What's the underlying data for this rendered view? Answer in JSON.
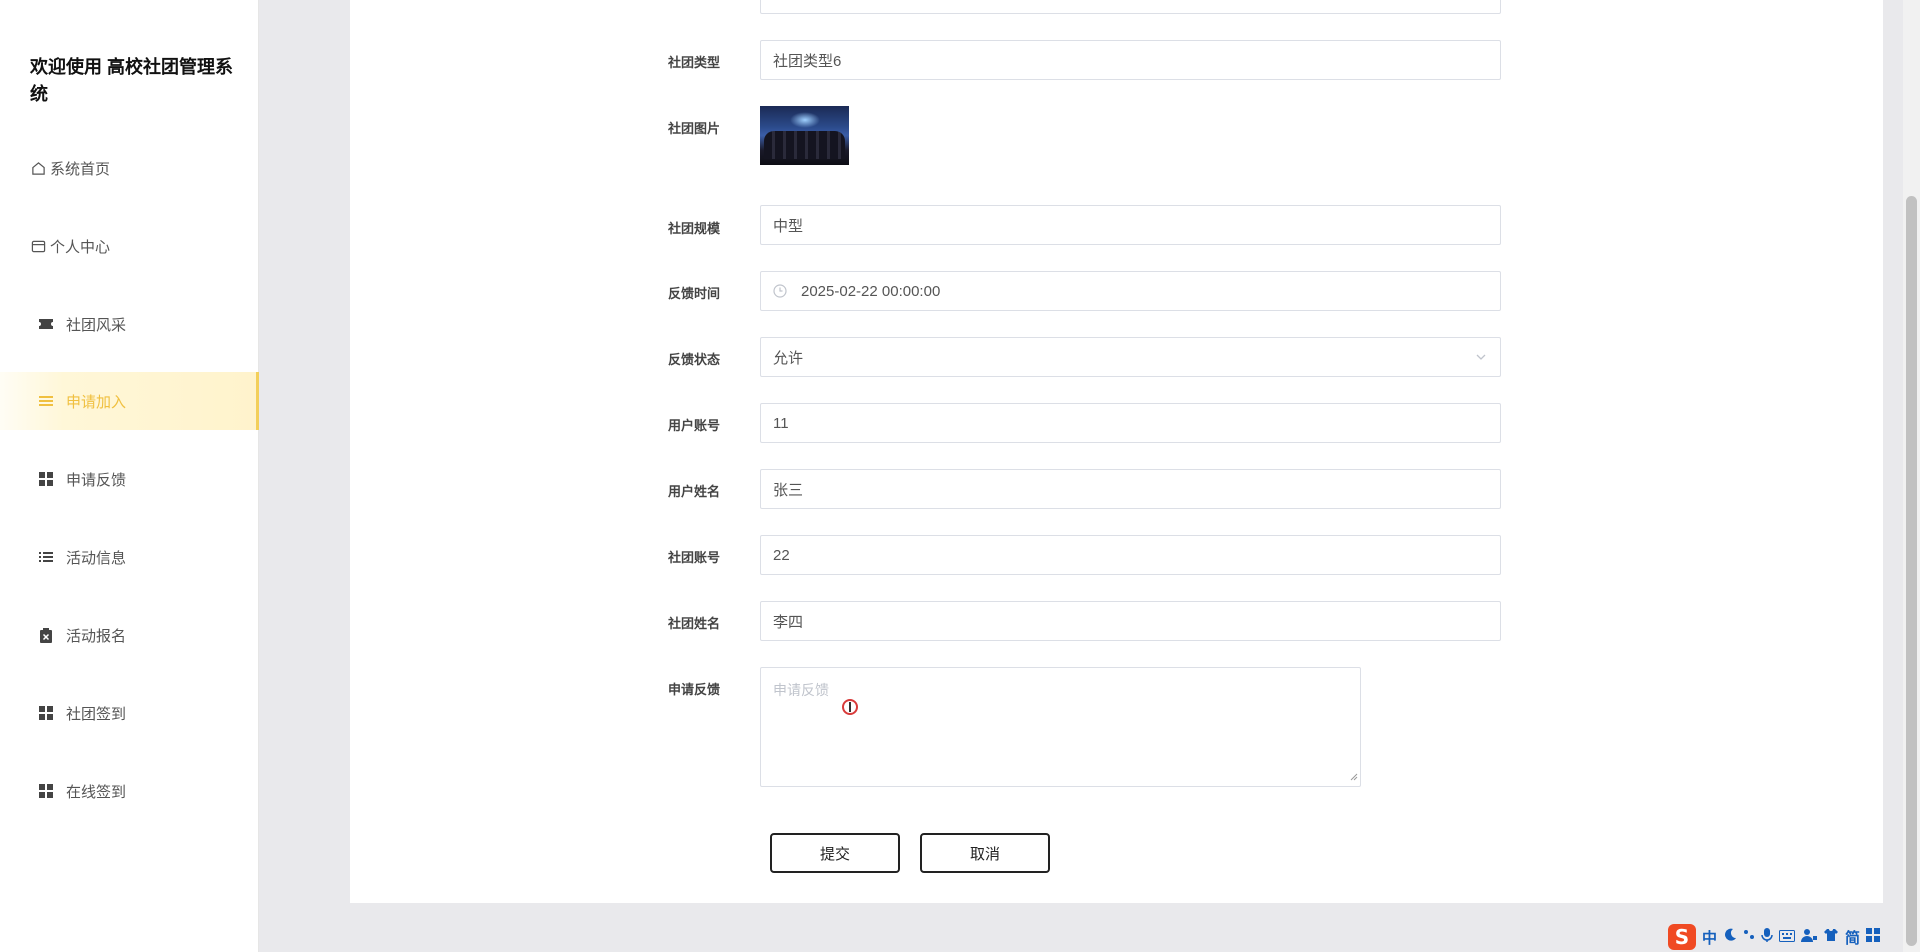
{
  "sidebar": {
    "title": "欢迎使用 高校社团管理系统",
    "items": [
      {
        "label": "系统首页",
        "icon": "home-icon"
      },
      {
        "label": "个人中心",
        "icon": "id-card-icon"
      },
      {
        "label": "社团风采",
        "icon": "ticket-icon"
      },
      {
        "label": "申请加入",
        "icon": "list-icon",
        "active": true
      },
      {
        "label": "申请反馈",
        "icon": "grid-icon"
      },
      {
        "label": "活动信息",
        "icon": "bullet-list-icon"
      },
      {
        "label": "活动报名",
        "icon": "clipboard-x-icon"
      },
      {
        "label": "社团签到",
        "icon": "grid-icon"
      },
      {
        "label": "在线签到",
        "icon": "grid-icon"
      }
    ]
  },
  "form": {
    "top_partial_value": "",
    "club_type": {
      "label": "社团类型",
      "value": "社团类型6"
    },
    "club_image": {
      "label": "社团图片"
    },
    "club_scale": {
      "label": "社团规模",
      "value": "中型"
    },
    "feedback_time": {
      "label": "反馈时间",
      "value": "2025-02-22 00:00:00"
    },
    "feedback_status": {
      "label": "反馈状态",
      "value": "允许"
    },
    "user_account": {
      "label": "用户账号",
      "value": "11"
    },
    "user_name": {
      "label": "用户姓名",
      "value": "张三"
    },
    "club_account": {
      "label": "社团账号",
      "value": "22"
    },
    "club_name": {
      "label": "社团姓名",
      "value": "李四"
    },
    "apply_feedback": {
      "label": "申请反馈",
      "placeholder": "申请反馈"
    },
    "submit_label": "提交",
    "cancel_label": "取消"
  },
  "ime": {
    "labels": [
      "中",
      "简"
    ]
  },
  "colors": {
    "accent": "#f0c040",
    "border": "#dcdfe6"
  }
}
